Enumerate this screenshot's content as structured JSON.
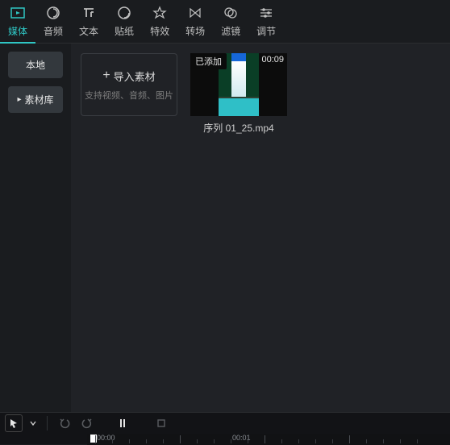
{
  "tabs": [
    {
      "label": "媒体",
      "icon": "media-icon"
    },
    {
      "label": "音频",
      "icon": "audio-icon"
    },
    {
      "label": "文本",
      "icon": "text-icon"
    },
    {
      "label": "贴纸",
      "icon": "sticker-icon"
    },
    {
      "label": "特效",
      "icon": "effect-icon"
    },
    {
      "label": "转场",
      "icon": "transition-icon"
    },
    {
      "label": "滤镜",
      "icon": "filter-icon"
    },
    {
      "label": "调节",
      "icon": "adjust-icon"
    }
  ],
  "sidebar": {
    "local": "本地",
    "library": "素材库"
  },
  "import": {
    "title": "导入素材",
    "hint": "支持视频、音频、图片"
  },
  "clip": {
    "badge": "已添加",
    "duration": "00:09",
    "name": "序列 01_25.mp4"
  },
  "timeline": {
    "t0": "00:00",
    "t1": "00:01"
  }
}
